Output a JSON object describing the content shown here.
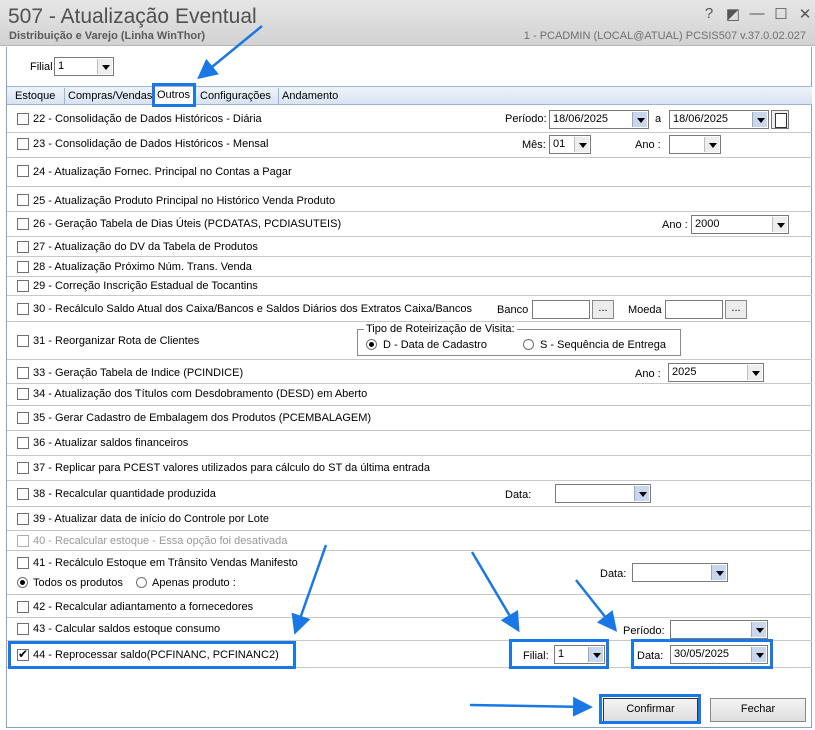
{
  "window": {
    "title": "507 - Atualização Eventual",
    "subtitle": "Distribuição e Varejo (Linha WinThor)",
    "connection": "1 - PCADMIN (LOCAL@ATUAL)   PCSIS507  v.37.0.02.027",
    "buttons": {
      "help": "?",
      "restore": "◩",
      "minimize": "—",
      "maximize": "☐",
      "close": "✕"
    }
  },
  "filial": {
    "label": "Filial",
    "value": "1"
  },
  "tabs": [
    "Estoque",
    "Compras/Vendas",
    "Outros",
    "Configurações",
    "Andamento"
  ],
  "rows": {
    "r22": "22 - Consolidação de Dados Históricos - Diária",
    "r23": "23 - Consolidação de Dados Históricos - Mensal",
    "r24": "24 - Atualização Fornec. Principal no Contas a Pagar",
    "r25": "25 - Atualização Produto Principal no Histórico Venda Produto",
    "r26": "26 - Geração Tabela de Dias Úteis (PCDATAS, PCDIASUTEIS)",
    "r27": "27 - Atualização do DV da Tabela de Produtos",
    "r28": "28 - Atualização Próximo Núm. Trans. Venda",
    "r29": "29 - Correção Inscrição Estadual de Tocantins",
    "r30": "30 - Recálculo Saldo Atual dos Caixa/Bancos e Saldos Diários dos Extratos Caixa/Bancos",
    "r31": "31 - Reorganizar Rota de Clientes",
    "r33": "33 - Geração Tabela de Indice (PCINDICE)",
    "r34": "34 - Atualização dos Títulos com Desdobramento (DESD) em Aberto",
    "r35": "35 - Gerar Cadastro de Embalagem dos Produtos (PCEMBALAGEM)",
    "r36": "36 - Atualizar saldos financeiros",
    "r37": "37 - Replicar para PCEST valores utilizados para cálculo do ST da última entrada",
    "r38": "38 - Recalcular quantidade produzida",
    "r39": "39 - Atualizar data de início do Controle por Lote",
    "r40": "40 - Recalcular estoque - Essa opção foi desativada",
    "r41": "41 - Recálculo Estoque em Trânsito Vendas Manifesto",
    "r42": "42 - Recalcular adiantamento a fornecedores",
    "r43": "43 - Calcular saldos estoque consumo",
    "r44": "44 - Reprocessar saldo(PCFINANC, PCFINANC2)"
  },
  "fields": {
    "periodo_label": "Período:",
    "periodo_start": "18/06/2025",
    "periodo_sep": "a",
    "periodo_end": "18/06/2025",
    "mes_label": "Mês:",
    "mes_value": "01",
    "ano_label": "Ano :",
    "ano_value": "",
    "ano26_label": "Ano :",
    "ano26_value": "2000",
    "banco_label": "Banco",
    "moeda_label": "Moeda",
    "dots": "...",
    "roteirizacao_title": "Tipo de Roteirização de Visita:",
    "rot_opt1": "D - Data de Cadastro",
    "rot_opt2": "S - Sequência de Entrega",
    "ano33_label": "Ano :",
    "ano33_value": "2025",
    "data38_label": "Data:",
    "data38_value": "",
    "r41_opt1": "Todos os produtos",
    "r41_opt2": "Apenas produto :",
    "data41_label": "Data:",
    "data41_value": "",
    "periodo43_label": "Período:",
    "periodo43_value": "",
    "filial44_label": "Filial:",
    "filial44_value": "1",
    "data44_label": "Data:",
    "data44_value": "30/05/2025"
  },
  "checked": {
    "r44": true
  },
  "actions": {
    "confirm": "Confirmar",
    "close": "Fechar"
  },
  "colors": {
    "highlight": "#1a78e6",
    "tab_active_bg": "#ffffff",
    "titlebar": "#d9d9d9"
  }
}
